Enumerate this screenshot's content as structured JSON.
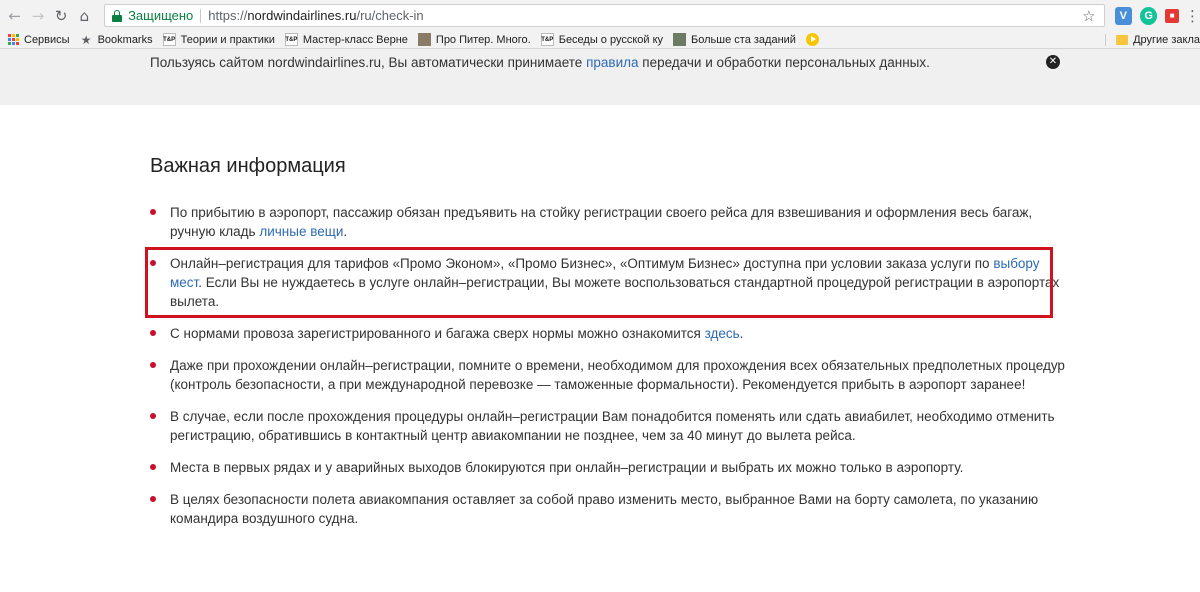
{
  "browser": {
    "secure_label": "Защищено",
    "url_proto": "https://",
    "url_host": "nordwindairlines.ru",
    "url_path": "/ru/check-in",
    "extensions": [
      "V",
      "G"
    ]
  },
  "bookmarks": {
    "apps_label": "Сервисы",
    "items": [
      {
        "label": "Bookmarks",
        "icon": "star-icon"
      },
      {
        "label": "Теории и практики",
        "icon": "tp-icon"
      },
      {
        "label": "Мастер-класс Верне",
        "icon": "tp-icon"
      },
      {
        "label": "Про Питер. Много.",
        "icon": "image-icon"
      },
      {
        "label": "Беседы о русской ку",
        "icon": "tp-icon"
      },
      {
        "label": "Больше ста заданий",
        "icon": "image-icon"
      }
    ],
    "other_label": "Другие закла"
  },
  "notice": {
    "text_before": "Пользуясь сайтом nordwindairlines.ru, Вы автоматически принимаете ",
    "link": "правила",
    "text_after": " передачи и обработки персональных данных."
  },
  "main": {
    "heading": "Важная информация",
    "items": [
      {
        "text": "По прибытию в аэропорт, пассажир обязан предъявить на стойку регистрации своего рейса для взвешивания и оформления весь багаж, ручную кладь ",
        "link": "личные вещи",
        "after": "."
      },
      {
        "text": "Онлайн–регистрация для тарифов «Промо Эконом», «Промо Бизнес», «Оптимум Бизнес» доступна при условии заказа услуги по ",
        "link": "выбору мест",
        "after": ". Если Вы не нуждаетесь в услуге онлайн–регистрации, Вы можете воспользоваться стандартной процедурой регистрации в аэропортах вылета."
      },
      {
        "text": "С нормами провоза зарегистрированного и багажа сверх нормы можно ознакомится ",
        "link": "здесь",
        "after": "."
      },
      {
        "text": "Даже при прохождении онлайн–регистрации, помните о времени, необходимом для прохождения всех обязательных предполетных процедур (контроль безопасности, а при международной перевозке — таможенные формальности). Рекомендуется прибыть в аэропорт заранее!",
        "link": "",
        "after": ""
      },
      {
        "text": "В случае, если после прохождения процедуры онлайн–регистрации Вам понадобится поменять или сдать авиабилет, необходимо отменить регистрацию, обратившись в контактный центр авиакомпании не позднее, чем за 40 минут до вылета рейса.",
        "link": "",
        "after": ""
      },
      {
        "text": "Места в первых рядах и у аварийных выходов блокируются при онлайн–регистрации и выбрать их можно только в аэропорту.",
        "link": "",
        "after": ""
      },
      {
        "text": "В целях безопасности полета авиакомпания оставляет за собой право изменить место, выбранное Вами на борту самолета, по указанию командира воздушного судна.",
        "link": "",
        "after": ""
      }
    ]
  },
  "colors": {
    "bullet": "#c8102e",
    "link": "#2d6ab3",
    "highlight_border": "#d0121f",
    "secure_green": "#0b8043"
  }
}
